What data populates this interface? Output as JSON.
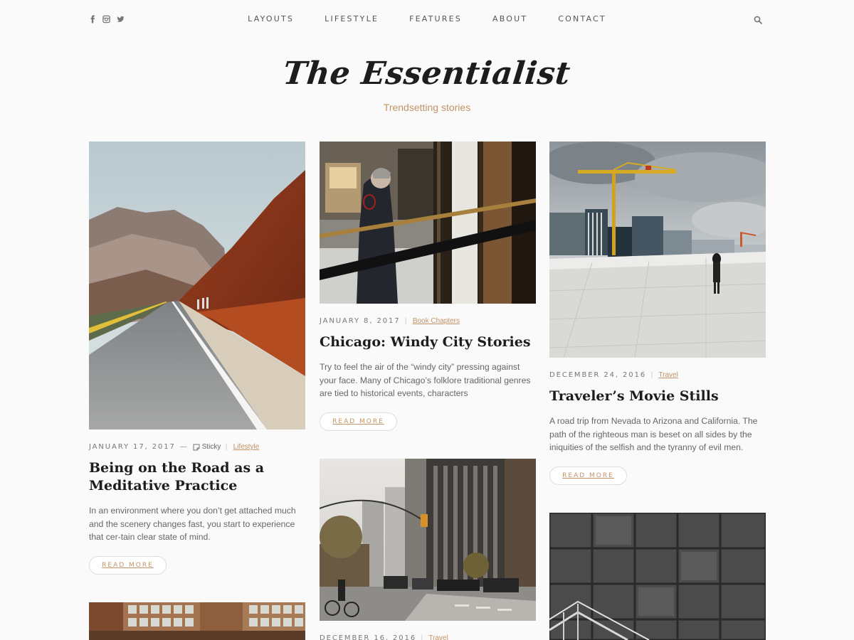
{
  "header": {
    "social": [
      {
        "icon": "facebook-icon"
      },
      {
        "icon": "instagram-icon"
      },
      {
        "icon": "twitter-icon"
      }
    ],
    "nav": [
      "LAYOUTS",
      "LIFESTYLE",
      "FEATURES",
      "ABOUT",
      "CONTACT"
    ],
    "search_icon": "search-icon"
  },
  "brand": {
    "logo": "The Essentialist",
    "tagline": "Trendsetting stories"
  },
  "colors": {
    "accent": "#c29366",
    "title": "#1d1d1d",
    "background": "#fafafa"
  },
  "posts": [
    {
      "date": "JANUARY 17, 2017",
      "dash": "—",
      "sticky": "Sticky",
      "category": "Lifestyle",
      "title": "Being on the Road as a Meditative Practice",
      "excerpt": "In an environment where you don’t get attached much and the scenery changes fast, you start to experience that cer-tain clear state of mind.",
      "button": "READ MORE"
    },
    {
      "date": "JANUARY 8, 2017",
      "category": "Book Chapters",
      "title": "Chicago: Windy City Stories",
      "excerpt": "Try to feel the air of the “windy city” pressing against your face. Many of Chicago’s folklore traditional genres are tied to historical events, characters",
      "button": "READ MORE"
    },
    {
      "date": "DECEMBER 24, 2016",
      "category": "Travel",
      "title": "Traveler’s Movie Stills",
      "excerpt": "A road trip from Nevada to Arizona and California. The path of the righteous man is beset on all sides by the iniquities of the selfish and the tyranny of evil men.",
      "button": "READ MORE"
    },
    {
      "date": "DECEMBER 16, 2016",
      "category": "Travel"
    }
  ]
}
